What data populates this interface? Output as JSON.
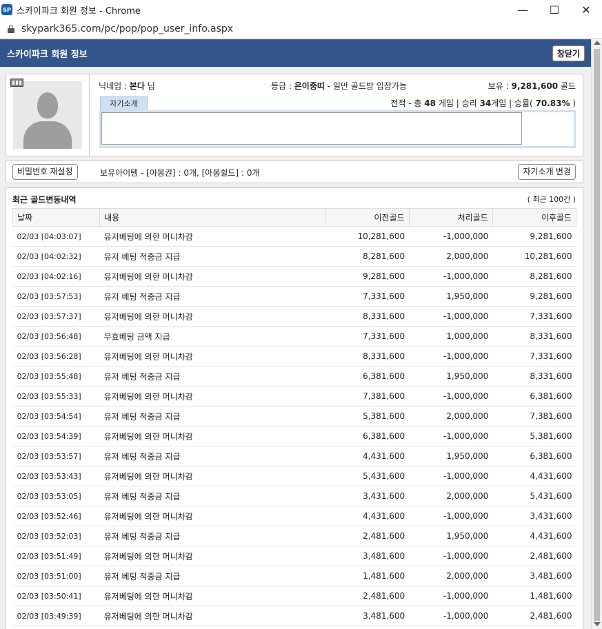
{
  "window": {
    "icon_label": "SP",
    "title": "스카이파크 회원 정보 - Chrome",
    "url": "skypark365.com/pc/pop/pop_user_info.aspx"
  },
  "header": {
    "title": "스카이파크 회원 정보",
    "close_label": "창닫기"
  },
  "profile": {
    "nick_label": "닉네임 : ",
    "nick": "본다",
    "nick_suffix": " 님",
    "grade_label": "등급 : ",
    "grade": "은이중띠",
    "grade_desc": " - 일만 골드방 입장가능",
    "hold_label": "보유 : ",
    "hold_amount": "9,281,600",
    "hold_unit": " 골드",
    "intro_tab": "자기소개",
    "record": {
      "prefix": "전적 - 총 ",
      "total": "48",
      "games1": " 게임 | 승리 ",
      "wins": "34",
      "games2": "게임 | 승률( ",
      "rate": "70.83%",
      "suffix": " )"
    }
  },
  "actions": {
    "reset_pw": "비밀번호 재설정",
    "items": "보유아이템 - [아봉권] : 0개, [아봉쉴드] : 0개",
    "change_intro": "자기소개 변경"
  },
  "history": {
    "title": "최근 골드변동내역",
    "count": "( 최근 100건 )",
    "columns": [
      "날짜",
      "내용",
      "이전골드",
      "처리골드",
      "이후골드"
    ],
    "rows": [
      [
        "02/03 [04:03:07]",
        "유저베팅에 의한 머니차감",
        "10,281,600",
        "-1,000,000",
        "9,281,600"
      ],
      [
        "02/03 [04:02:32]",
        "유저 베팅 적중금 지급",
        "8,281,600",
        "2,000,000",
        "10,281,600"
      ],
      [
        "02/03 [04:02:16]",
        "유저베팅에 의한 머니차감",
        "9,281,600",
        "-1,000,000",
        "8,281,600"
      ],
      [
        "02/03 [03:57:53]",
        "유저 베팅 적중금 지급",
        "7,331,600",
        "1,950,000",
        "9,281,600"
      ],
      [
        "02/03 [03:57:37]",
        "유저베팅에 의한 머니차감",
        "8,331,600",
        "-1,000,000",
        "7,331,600"
      ],
      [
        "02/03 [03:56:48]",
        "무효베팅 금액 지급",
        "7,331,600",
        "1,000,000",
        "8,331,600"
      ],
      [
        "02/03 [03:56:28]",
        "유저베팅에 의한 머니차감",
        "8,331,600",
        "-1,000,000",
        "7,331,600"
      ],
      [
        "02/03 [03:55:48]",
        "유저 베팅 적중금 지급",
        "6,381,600",
        "1,950,000",
        "8,331,600"
      ],
      [
        "02/03 [03:55:33]",
        "유저베팅에 의한 머니차감",
        "7,381,600",
        "-1,000,000",
        "6,381,600"
      ],
      [
        "02/03 [03:54:54]",
        "유저 베팅 적중금 지급",
        "5,381,600",
        "2,000,000",
        "7,381,600"
      ],
      [
        "02/03 [03:54:39]",
        "유저베팅에 의한 머니차감",
        "6,381,600",
        "-1,000,000",
        "5,381,600"
      ],
      [
        "02/03 [03:53:57]",
        "유저 베팅 적중금 지급",
        "4,431,600",
        "1,950,000",
        "6,381,600"
      ],
      [
        "02/03 [03:53:43]",
        "유저베팅에 의한 머니차감",
        "5,431,600",
        "-1,000,000",
        "4,431,600"
      ],
      [
        "02/03 [03:53:05]",
        "유저 베팅 적중금 지급",
        "3,431,600",
        "2,000,000",
        "5,431,600"
      ],
      [
        "02/03 [03:52:46]",
        "유저베팅에 의한 머니차감",
        "4,431,600",
        "-1,000,000",
        "3,431,600"
      ],
      [
        "02/03 [03:52:03]",
        "유저 베팅 적중금 지급",
        "2,481,600",
        "1,950,000",
        "4,431,600"
      ],
      [
        "02/03 [03:51:49]",
        "유저베팅에 의한 머니차감",
        "3,481,600",
        "-1,000,000",
        "2,481,600"
      ],
      [
        "02/03 [03:51:00]",
        "유저 베팅 적중금 지급",
        "1,481,600",
        "2,000,000",
        "3,481,600"
      ],
      [
        "02/03 [03:50:41]",
        "유저베팅에 의한 머니차감",
        "2,481,600",
        "-1,000,000",
        "1,481,600"
      ],
      [
        "02/03 [03:49:39]",
        "유저베팅에 의한 머니차감",
        "3,481,600",
        "-1,000,000",
        "2,481,600"
      ]
    ]
  }
}
